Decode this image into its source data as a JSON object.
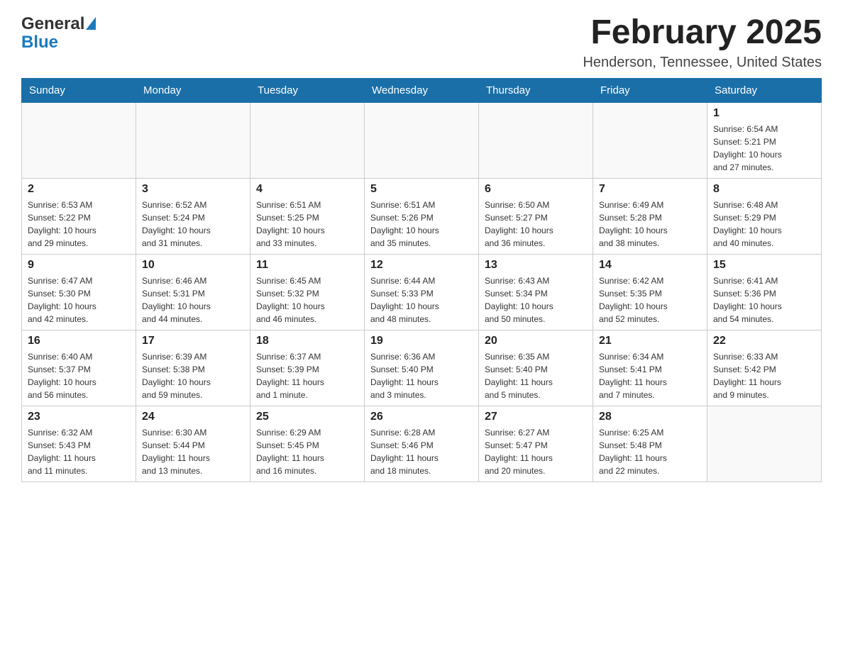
{
  "header": {
    "logo_general": "General",
    "logo_blue": "Blue",
    "month_title": "February 2025",
    "location": "Henderson, Tennessee, United States"
  },
  "weekdays": [
    "Sunday",
    "Monday",
    "Tuesday",
    "Wednesday",
    "Thursday",
    "Friday",
    "Saturday"
  ],
  "weeks": [
    [
      {
        "day": "",
        "info": ""
      },
      {
        "day": "",
        "info": ""
      },
      {
        "day": "",
        "info": ""
      },
      {
        "day": "",
        "info": ""
      },
      {
        "day": "",
        "info": ""
      },
      {
        "day": "",
        "info": ""
      },
      {
        "day": "1",
        "info": "Sunrise: 6:54 AM\nSunset: 5:21 PM\nDaylight: 10 hours\nand 27 minutes."
      }
    ],
    [
      {
        "day": "2",
        "info": "Sunrise: 6:53 AM\nSunset: 5:22 PM\nDaylight: 10 hours\nand 29 minutes."
      },
      {
        "day": "3",
        "info": "Sunrise: 6:52 AM\nSunset: 5:24 PM\nDaylight: 10 hours\nand 31 minutes."
      },
      {
        "day": "4",
        "info": "Sunrise: 6:51 AM\nSunset: 5:25 PM\nDaylight: 10 hours\nand 33 minutes."
      },
      {
        "day": "5",
        "info": "Sunrise: 6:51 AM\nSunset: 5:26 PM\nDaylight: 10 hours\nand 35 minutes."
      },
      {
        "day": "6",
        "info": "Sunrise: 6:50 AM\nSunset: 5:27 PM\nDaylight: 10 hours\nand 36 minutes."
      },
      {
        "day": "7",
        "info": "Sunrise: 6:49 AM\nSunset: 5:28 PM\nDaylight: 10 hours\nand 38 minutes."
      },
      {
        "day": "8",
        "info": "Sunrise: 6:48 AM\nSunset: 5:29 PM\nDaylight: 10 hours\nand 40 minutes."
      }
    ],
    [
      {
        "day": "9",
        "info": "Sunrise: 6:47 AM\nSunset: 5:30 PM\nDaylight: 10 hours\nand 42 minutes."
      },
      {
        "day": "10",
        "info": "Sunrise: 6:46 AM\nSunset: 5:31 PM\nDaylight: 10 hours\nand 44 minutes."
      },
      {
        "day": "11",
        "info": "Sunrise: 6:45 AM\nSunset: 5:32 PM\nDaylight: 10 hours\nand 46 minutes."
      },
      {
        "day": "12",
        "info": "Sunrise: 6:44 AM\nSunset: 5:33 PM\nDaylight: 10 hours\nand 48 minutes."
      },
      {
        "day": "13",
        "info": "Sunrise: 6:43 AM\nSunset: 5:34 PM\nDaylight: 10 hours\nand 50 minutes."
      },
      {
        "day": "14",
        "info": "Sunrise: 6:42 AM\nSunset: 5:35 PM\nDaylight: 10 hours\nand 52 minutes."
      },
      {
        "day": "15",
        "info": "Sunrise: 6:41 AM\nSunset: 5:36 PM\nDaylight: 10 hours\nand 54 minutes."
      }
    ],
    [
      {
        "day": "16",
        "info": "Sunrise: 6:40 AM\nSunset: 5:37 PM\nDaylight: 10 hours\nand 56 minutes."
      },
      {
        "day": "17",
        "info": "Sunrise: 6:39 AM\nSunset: 5:38 PM\nDaylight: 10 hours\nand 59 minutes."
      },
      {
        "day": "18",
        "info": "Sunrise: 6:37 AM\nSunset: 5:39 PM\nDaylight: 11 hours\nand 1 minute."
      },
      {
        "day": "19",
        "info": "Sunrise: 6:36 AM\nSunset: 5:40 PM\nDaylight: 11 hours\nand 3 minutes."
      },
      {
        "day": "20",
        "info": "Sunrise: 6:35 AM\nSunset: 5:40 PM\nDaylight: 11 hours\nand 5 minutes."
      },
      {
        "day": "21",
        "info": "Sunrise: 6:34 AM\nSunset: 5:41 PM\nDaylight: 11 hours\nand 7 minutes."
      },
      {
        "day": "22",
        "info": "Sunrise: 6:33 AM\nSunset: 5:42 PM\nDaylight: 11 hours\nand 9 minutes."
      }
    ],
    [
      {
        "day": "23",
        "info": "Sunrise: 6:32 AM\nSunset: 5:43 PM\nDaylight: 11 hours\nand 11 minutes."
      },
      {
        "day": "24",
        "info": "Sunrise: 6:30 AM\nSunset: 5:44 PM\nDaylight: 11 hours\nand 13 minutes."
      },
      {
        "day": "25",
        "info": "Sunrise: 6:29 AM\nSunset: 5:45 PM\nDaylight: 11 hours\nand 16 minutes."
      },
      {
        "day": "26",
        "info": "Sunrise: 6:28 AM\nSunset: 5:46 PM\nDaylight: 11 hours\nand 18 minutes."
      },
      {
        "day": "27",
        "info": "Sunrise: 6:27 AM\nSunset: 5:47 PM\nDaylight: 11 hours\nand 20 minutes."
      },
      {
        "day": "28",
        "info": "Sunrise: 6:25 AM\nSunset: 5:48 PM\nDaylight: 11 hours\nand 22 minutes."
      },
      {
        "day": "",
        "info": ""
      }
    ]
  ]
}
